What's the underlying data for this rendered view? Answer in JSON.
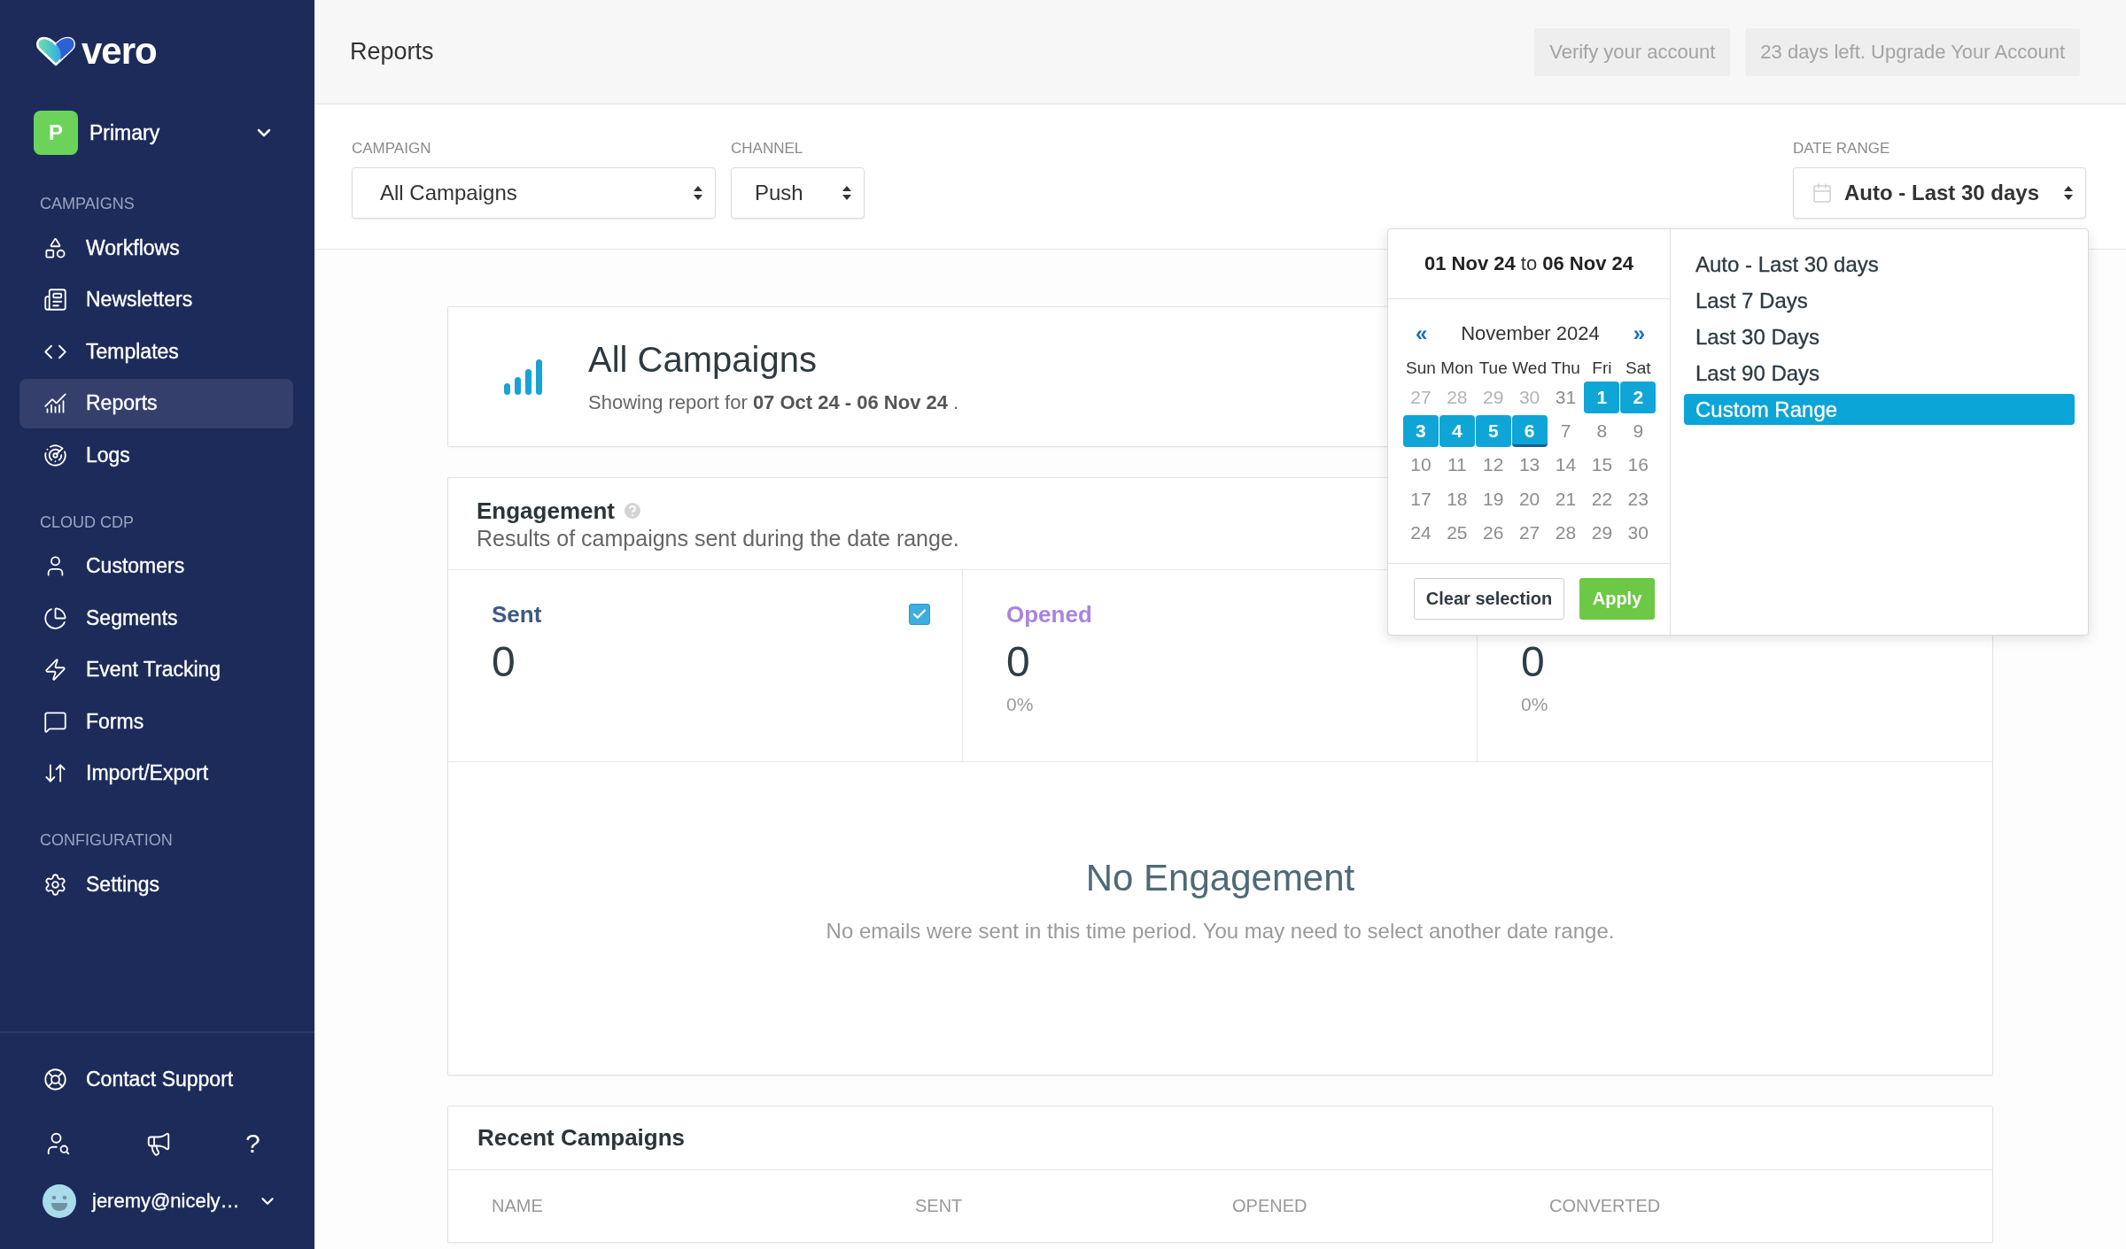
{
  "sidebar": {
    "logo_text": "vero",
    "workspace": {
      "initial": "P",
      "name": "Primary"
    },
    "sections": [
      {
        "title": "CAMPAIGNS",
        "items": [
          {
            "label": "Workflows",
            "selected": false
          },
          {
            "label": "Newsletters",
            "selected": false
          },
          {
            "label": "Templates",
            "selected": false
          },
          {
            "label": "Reports",
            "selected": true
          },
          {
            "label": "Logs",
            "selected": false
          }
        ]
      },
      {
        "title": "CLOUD CDP",
        "items": [
          {
            "label": "Customers",
            "selected": false
          },
          {
            "label": "Segments",
            "selected": false
          },
          {
            "label": "Event Tracking",
            "selected": false
          },
          {
            "label": "Forms",
            "selected": false
          },
          {
            "label": "Import/Export",
            "selected": false
          }
        ]
      },
      {
        "title": "CONFIGURATION",
        "items": [
          {
            "label": "Settings",
            "selected": false
          }
        ]
      }
    ],
    "support_link": "Contact Support",
    "help_text": "?",
    "user_email": "jeremy@nicely…"
  },
  "header": {
    "title": "Reports",
    "buttons": [
      "Verify your account",
      "23 days left. Upgrade Your Account"
    ]
  },
  "filters": [
    {
      "label": "CAMPAIGN",
      "value": "All Campaigns"
    },
    {
      "label": "CHANNEL",
      "value": "Push"
    }
  ],
  "date_range": {
    "label": "DATE RANGE",
    "value": "Auto - Last 30 days"
  },
  "date_picker": {
    "range_text": "**01 Nov 24** to **06 Nov 24**",
    "prev": "«",
    "month": "November 2024",
    "next": "»",
    "weekdays": [
      "Sun",
      "Mon",
      "Tue",
      "Wed",
      "Thu",
      "Fri",
      "Sat"
    ],
    "weeks": [
      [
        {
          "day": "27",
          "selected": false,
          "disabled": true,
          "today": false
        },
        {
          "day": "28",
          "selected": false,
          "disabled": true,
          "today": false
        },
        {
          "day": "29",
          "selected": false,
          "disabled": true,
          "today": false
        },
        {
          "day": "30",
          "selected": false,
          "disabled": true,
          "today": false
        },
        {
          "day": "31",
          "selected": false,
          "disabled": false,
          "today": false
        },
        {
          "day": "1",
          "selected": true,
          "disabled": false,
          "today": false
        },
        {
          "day": "2",
          "selected": true,
          "disabled": false,
          "today": false
        }
      ],
      [
        {
          "day": "3",
          "selected": true,
          "disabled": false,
          "today": false
        },
        {
          "day": "4",
          "selected": true,
          "disabled": false,
          "today": false
        },
        {
          "day": "5",
          "selected": true,
          "disabled": false,
          "today": false
        },
        {
          "day": "6",
          "selected": true,
          "disabled": false,
          "today": true
        },
        {
          "day": "7",
          "selected": false,
          "disabled": false,
          "today": false
        },
        {
          "day": "8",
          "selected": false,
          "disabled": false,
          "today": false
        },
        {
          "day": "9",
          "selected": false,
          "disabled": false,
          "today": false
        }
      ],
      [
        {
          "day": "10",
          "selected": false,
          "disabled": false,
          "today": false
        },
        {
          "day": "11",
          "selected": false,
          "disabled": false,
          "today": false
        },
        {
          "day": "12",
          "selected": false,
          "disabled": false,
          "today": false
        },
        {
          "day": "13",
          "selected": false,
          "disabled": false,
          "today": false
        },
        {
          "day": "14",
          "selected": false,
          "disabled": false,
          "today": false
        },
        {
          "day": "15",
          "selected": false,
          "disabled": false,
          "today": false
        },
        {
          "day": "16",
          "selected": false,
          "disabled": false,
          "today": false
        }
      ],
      [
        {
          "day": "17",
          "selected": false,
          "disabled": false,
          "today": false
        },
        {
          "day": "18",
          "selected": false,
          "disabled": false,
          "today": false
        },
        {
          "day": "19",
          "selected": false,
          "disabled": false,
          "today": false
        },
        {
          "day": "20",
          "selected": false,
          "disabled": false,
          "today": false
        },
        {
          "day": "21",
          "selected": false,
          "disabled": false,
          "today": false
        },
        {
          "day": "22",
          "selected": false,
          "disabled": false,
          "today": false
        },
        {
          "day": "23",
          "selected": false,
          "disabled": false,
          "today": false
        }
      ],
      [
        {
          "day": "24",
          "selected": false,
          "disabled": false,
          "today": false
        },
        {
          "day": "25",
          "selected": false,
          "disabled": false,
          "today": false
        },
        {
          "day": "26",
          "selected": false,
          "disabled": false,
          "today": false
        },
        {
          "day": "27",
          "selected": false,
          "disabled": false,
          "today": false
        },
        {
          "day": "28",
          "selected": false,
          "disabled": false,
          "today": false
        },
        {
          "day": "29",
          "selected": false,
          "disabled": false,
          "today": false
        },
        {
          "day": "30",
          "selected": false,
          "disabled": false,
          "today": false
        }
      ]
    ],
    "clear_button": "Clear selection",
    "apply_button": "Apply",
    "presets": [
      {
        "label": "Auto - Last 30 days",
        "selected": false
      },
      {
        "label": "Last 7 Days",
        "selected": false
      },
      {
        "label": "Last 30 Days",
        "selected": false
      },
      {
        "label": "Last 90 Days",
        "selected": false
      },
      {
        "label": "Custom Range",
        "selected": true
      }
    ]
  },
  "summary": {
    "title": "All Campaigns",
    "subtitle": "Showing report for **07 Oct 24 - 06 Nov 24** ."
  },
  "engagement": {
    "title": "Engagement",
    "description": "Results of campaigns sent during the date range.",
    "stats": [
      {
        "label": "Sent",
        "color": "#3e5a82",
        "value": "0",
        "checked": true
      },
      {
        "label": "Opened",
        "color": "#a784e0",
        "value": "0",
        "percent": "0%"
      },
      {
        "value": "0",
        "percent": "0%"
      }
    ],
    "empty_title": "No Engagement",
    "empty_message": "No emails were sent in this time period. You may need to select another date range."
  },
  "recent_campaigns": {
    "title": "Recent Campaigns",
    "columns": [
      "NAME",
      "SENT",
      "OPENED",
      "CONVERTED"
    ]
  }
}
